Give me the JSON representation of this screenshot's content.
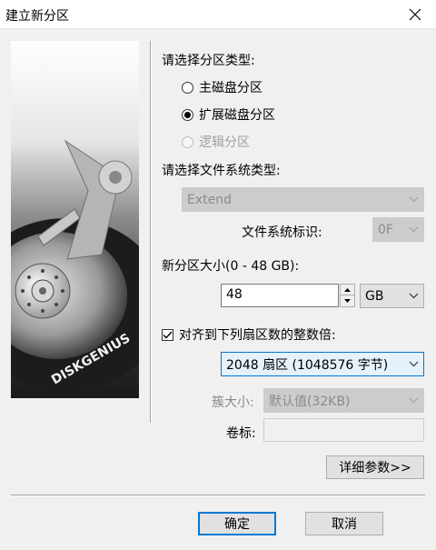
{
  "window": {
    "title": "建立新分区"
  },
  "image": {
    "brand": "DISKGENIUS"
  },
  "partition_type": {
    "label": "请选择分区类型:",
    "options": [
      {
        "label": "主磁盘分区",
        "checked": false,
        "disabled": false
      },
      {
        "label": "扩展磁盘分区",
        "checked": true,
        "disabled": false
      },
      {
        "label": "逻辑分区",
        "checked": false,
        "disabled": true
      }
    ]
  },
  "filesystem": {
    "label": "请选择文件系统类型:",
    "value": "Extend",
    "id_label": "文件系统标识:",
    "id_value": "0F"
  },
  "size": {
    "label": "新分区大小(0 - 48 GB):",
    "value": "48",
    "unit": "GB"
  },
  "align": {
    "label": "对齐到下列扇区数的整数倍:",
    "checked": true,
    "value": "2048 扇区 (1048576 字节)"
  },
  "cluster": {
    "label": "簇大小:",
    "value": "默认值(32KB)"
  },
  "volume": {
    "label": "卷标:",
    "value": ""
  },
  "buttons": {
    "details": "详细参数>>",
    "ok": "确定",
    "cancel": "取消"
  }
}
